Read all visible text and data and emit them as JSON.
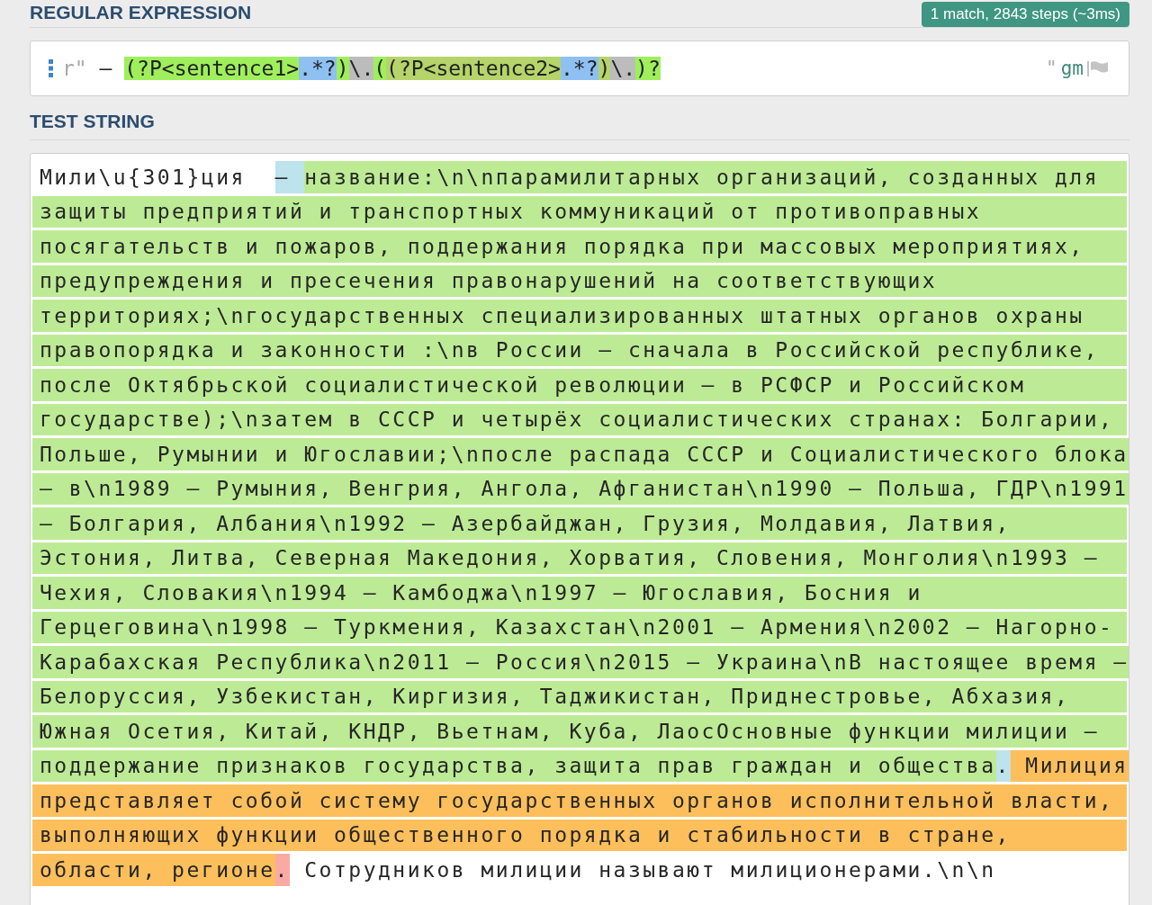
{
  "regex_section": {
    "title": "REGULAR EXPRESSION",
    "match_info": "1 match, 2843 steps (~3ms)"
  },
  "regex": {
    "tokens": [
      {
        "kind": "delimiter",
        "text": "r\""
      },
      {
        "kind": "literal",
        "text": " – "
      },
      {
        "kind": "group1",
        "text": "(?P<sentence1>"
      },
      {
        "kind": "quantifier",
        "text": ".*?"
      },
      {
        "kind": "group1",
        "text": ")"
      },
      {
        "kind": "escape",
        "text": "\\."
      },
      {
        "kind": "group0",
        "text": "("
      },
      {
        "kind": "group2",
        "text": "(?P<sentence2>"
      },
      {
        "kind": "quantifier",
        "text": ".*?"
      },
      {
        "kind": "group2",
        "text": ")"
      },
      {
        "kind": "escape",
        "text": "\\."
      },
      {
        "kind": "group0",
        "text": ")?"
      }
    ],
    "closing_delimiter": "\"",
    "flags": "gm"
  },
  "test_section": {
    "title": "TEST STRING"
  },
  "test_string": {
    "lines": [
      [
        {
          "kind": "plain",
          "text": "Мили\\u{301}ция  "
        },
        {
          "kind": "start",
          "text": "– "
        },
        {
          "kind": "group1",
          "text": "название:\\n\\nпарамилитарных организаций, созданных для"
        }
      ],
      [
        {
          "kind": "group1",
          "text": "защиты предприятий и транспортных коммуникаций от противоправных"
        }
      ],
      [
        {
          "kind": "group1",
          "text": "посягательств и пожаров, поддержания порядка при массовых мероприятиях,"
        }
      ],
      [
        {
          "kind": "group1",
          "text": "предупреждения и пресечения правонарушений на соответствующих"
        }
      ],
      [
        {
          "kind": "group1",
          "text": "территориях;\\nгосударственных специализированных штатных органов охраны"
        }
      ],
      [
        {
          "kind": "group1",
          "text": "правопорядка и законности :\\nв России – сначала в Российской республике,"
        }
      ],
      [
        {
          "kind": "group1",
          "text": "после Октябрьской социалистической революции – в РСФСР и Российском"
        }
      ],
      [
        {
          "kind": "group1",
          "text": "государстве);\\nзатем в СССР и четырёх социалистических странах: Болгарии,"
        }
      ],
      [
        {
          "kind": "group1",
          "text": "Польше, Румынии и Югославии;\\nпосле распада СССР и Социалистического блока"
        }
      ],
      [
        {
          "kind": "group1",
          "text": "– в\\n1989 – Румыния, Венгрия, Ангола, Афганистан\\n1990 – Польша, ГДР\\n1991"
        }
      ],
      [
        {
          "kind": "group1",
          "text": "– Болгария, Албания\\n1992 – Азербайджан, Грузия, Молдавия, Латвия,"
        }
      ],
      [
        {
          "kind": "group1",
          "text": "Эстония, Литва, Северная Македония, Хорватия, Словения, Монголия\\n1993 –"
        }
      ],
      [
        {
          "kind": "group1",
          "text": "Чехия, Словакия\\n1994 – Камбоджа\\n1997 – Югославия, Босния и"
        }
      ],
      [
        {
          "kind": "group1",
          "text": "Герцеговина\\n1998 – Туркмения, Казахстан\\n2001 – Армения\\n2002 – Нагорно-"
        }
      ],
      [
        {
          "kind": "group1",
          "text": "Карабахская Республика\\n2011 – Россия\\n2015 – Украина\\nВ настоящее время –"
        }
      ],
      [
        {
          "kind": "group1",
          "text": "Белоруссия, Узбекистан, Киргизия, Таджикистан, Приднестровье, Абхазия,"
        }
      ],
      [
        {
          "kind": "group1",
          "text": "Южная Осетия, Китай, КНДР, Вьетнам, Куба, ЛаосОсновные функции милиции –"
        }
      ],
      [
        {
          "kind": "group1",
          "text": "поддержание признаков государства, защита прав граждан и общества"
        },
        {
          "kind": "dot",
          "text": "."
        },
        {
          "kind": "group2",
          "text": " Милиция"
        }
      ],
      [
        {
          "kind": "group2",
          "text": "представляет собой систему государственных органов исполнительной власти,"
        }
      ],
      [
        {
          "kind": "group2",
          "text": "выполняющих функции общественного порядка и стабильности в стране,"
        }
      ],
      [
        {
          "kind": "group2",
          "text": "области, регионе"
        },
        {
          "kind": "end",
          "text": "."
        },
        {
          "kind": "plain",
          "text": " Сотрудников милиции называют милиционерами.\\n\\n"
        }
      ]
    ]
  }
}
